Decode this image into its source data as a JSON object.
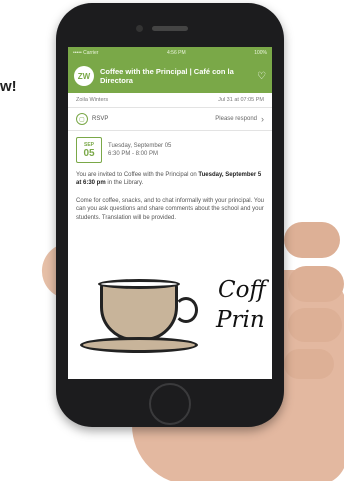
{
  "edge_text": "w!",
  "status_bar": {
    "carrier": "••••• Carrier",
    "time": "4:56 PM",
    "battery": "100%"
  },
  "app_bar": {
    "avatar_initials": "ZW",
    "title": "Coffee with the Principal | Café con la Directora"
  },
  "meta": {
    "sender": "Zoila Winters",
    "sent": "Jul 31 at 07:05 PM"
  },
  "rsvp": {
    "label": "RSVP",
    "respond_label": "Please respond"
  },
  "event_date": {
    "month": "SEP",
    "day": "05",
    "line1": "Tuesday, September 05",
    "line2": "6:30 PM - 8:00 PM"
  },
  "body": {
    "p1_a": "You are invited to Coffee with the Principal on ",
    "p1_bold": "Tuesday, September 5 at 6:30 pm",
    "p1_b": " in the Library.",
    "p2": "Come for coffee, snacks, and to chat informally with your principal. You can you ask questions and share comments about the school and your students. Translation will be provided."
  },
  "artwork": {
    "script_line1": "Coff",
    "script_line2": "Prin"
  },
  "colors": {
    "accent": "#7aa848"
  }
}
